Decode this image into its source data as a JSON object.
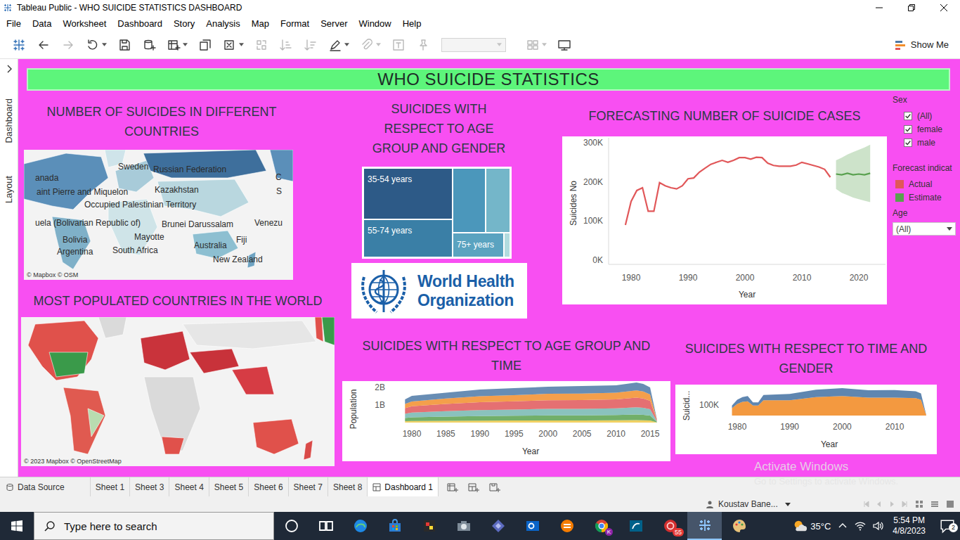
{
  "window": {
    "title": "Tableau Public - WHO SUICIDE STATISTICS DASHBOARD"
  },
  "menu": [
    "File",
    "Data",
    "Worksheet",
    "Dashboard",
    "Story",
    "Analysis",
    "Map",
    "Format",
    "Server",
    "Window",
    "Help"
  ],
  "toolbar": {
    "buttons": [
      {
        "kind": "logo",
        "disabled": false,
        "menu": false
      },
      {
        "kind": "undo",
        "disabled": false,
        "menu": false
      },
      {
        "kind": "redo",
        "disabled": true,
        "menu": false
      },
      {
        "kind": "replay",
        "disabled": false,
        "menu": true
      },
      {
        "kind": "save",
        "disabled": false,
        "menu": false
      },
      {
        "kind": "datasource",
        "disabled": false,
        "menu": false
      },
      {
        "kind": "newsheet",
        "disabled": false,
        "menu": true
      },
      {
        "kind": "duplicate",
        "disabled": false,
        "menu": false
      },
      {
        "kind": "clear",
        "disabled": false,
        "menu": true
      },
      {
        "kind": "swap",
        "disabled": true,
        "menu": false
      },
      {
        "kind": "sortasc",
        "disabled": true,
        "menu": false
      },
      {
        "kind": "sortdesc",
        "disabled": true,
        "menu": false
      },
      {
        "kind": "highlight",
        "disabled": false,
        "menu": true
      },
      {
        "kind": "attach",
        "disabled": true,
        "menu": true
      },
      {
        "kind": "label",
        "disabled": true,
        "menu": false
      },
      {
        "kind": "pin",
        "disabled": true,
        "menu": false
      },
      {
        "kind": "fitfield",
        "disabled": true,
        "menu": true
      },
      {
        "kind": "cards",
        "disabled": true,
        "menu": true
      },
      {
        "kind": "present",
        "disabled": false,
        "menu": false
      }
    ],
    "show_me": "Show Me"
  },
  "side_panel": {
    "tabs": [
      "Dashboard",
      "Layout"
    ]
  },
  "dashboard": {
    "title": "WHO SUICIDE STATISTICS",
    "country_map": {
      "title": "NUMBER OF SUICIDES IN DIFFERENT COUNTRIES",
      "labels": [
        "anada",
        "Sweden",
        "Russian Federation",
        "C",
        "aint Pierre and Miquelon",
        "Kazakhstan",
        "S",
        "Occupied Palestinian Territory",
        "uela (Bolivarian Republic of)",
        "Brunei Darussalam",
        "Venezu",
        "Mayotte",
        "Fiji",
        "Bolivia",
        "Argentina",
        "South Africa",
        "Australia",
        "New Zealand"
      ],
      "attribution": "© Mapbox © OSM"
    },
    "population_map": {
      "title": "MOST POPULATED COUNTRIES IN THE WORLD",
      "attribution": "© 2023 Mapbox © OpenStreetMap"
    },
    "treemap": {
      "title": "SUICIDES WITH RESPECT TO AGE GROUP AND GENDER",
      "cells": [
        {
          "label": "35-54 years",
          "value": 9271,
          "color": "#2d5a87"
        },
        {
          "label": "55-74 years",
          "value": 6731,
          "color": "#3a7fa6"
        },
        {
          "value": 4324,
          "color": "#4b97bb"
        },
        {
          "value": 3128,
          "color": "#74b6c9"
        },
        {
          "label": "75+ years",
          "value": 2550,
          "color": "#5aa3c0"
        },
        {
          "value": 238,
          "color": "#b2dcdf"
        }
      ]
    },
    "logo": {
      "lines": [
        "World Health",
        "Organization"
      ]
    },
    "forecast": {
      "title": "FORECASTING NUMBER OF SUICIDE CASES",
      "y_axis": {
        "label": "Suicides No",
        "ticks": [
          "300K",
          "200K",
          "100K",
          "0K"
        ]
      },
      "x_axis": {
        "label": "Year",
        "ticks": [
          "1980",
          "1990",
          "2000",
          "2010",
          "2020"
        ]
      },
      "actual": {
        "start_year": 1979,
        "values": [
          90000,
          150000,
          178000,
          185000,
          125000,
          125000,
          198000,
          190000,
          185000,
          182000,
          190000,
          208000,
          210000,
          225000,
          235000,
          245000,
          250000,
          255000,
          250000,
          255000,
          262000,
          262000,
          258000,
          263000,
          262000,
          248000,
          242000,
          240000,
          240000,
          240000,
          243000,
          250000,
          246000,
          242000,
          238000,
          232000,
          212000
        ]
      },
      "estimate": {
        "start_year": 2016,
        "values": [
          220000,
          218000,
          222000,
          218000,
          220000,
          218000,
          222000
        ],
        "lower": [
          182000,
          172000,
          166000,
          160000,
          156000,
          152000,
          148000
        ],
        "upper": [
          255000,
          262000,
          270000,
          276000,
          282000,
          288000,
          295000
        ]
      }
    },
    "filters": {
      "sex": {
        "title": "Sex",
        "options": [
          {
            "label": "(All)",
            "checked": true
          },
          {
            "label": "female",
            "checked": true
          },
          {
            "label": "male",
            "checked": true
          }
        ]
      },
      "forecast_indicator": {
        "title": "Forecast indicat",
        "items": [
          {
            "label": "Actual",
            "color": "#e15759"
          },
          {
            "label": "Estimate",
            "color": "#59a14f"
          }
        ]
      },
      "age": {
        "title": "Age",
        "value": "(All)"
      }
    },
    "age_time": {
      "title": "SUICIDES WITH RESPECT TO AGE GROUP AND TIME",
      "y_axis": {
        "label": "Population",
        "ticks": [
          "2B",
          "1B"
        ]
      },
      "x_axis": {
        "label": "Year",
        "ticks": [
          "1980",
          "1985",
          "1990",
          "1995",
          "2000",
          "2005",
          "2010",
          "2015"
        ]
      },
      "years": [
        1979,
        1980,
        1985,
        1990,
        1995,
        2000,
        2005,
        2010,
        2013,
        2014,
        2015,
        2016
      ],
      "series": [
        {
          "color": "#edc948",
          "values": [
            0.08,
            0.09,
            0.1,
            0.11,
            0.12,
            0.12,
            0.12,
            0.13,
            0.14,
            0.13,
            0.12,
            0.01
          ]
        },
        {
          "color": "#59a14f",
          "values": [
            0.18,
            0.21,
            0.24,
            0.26,
            0.27,
            0.29,
            0.29,
            0.3,
            0.32,
            0.31,
            0.28,
            0.03
          ]
        },
        {
          "color": "#76b7b2",
          "values": [
            0.24,
            0.27,
            0.31,
            0.34,
            0.35,
            0.37,
            0.37,
            0.38,
            0.41,
            0.4,
            0.36,
            0.04
          ]
        },
        {
          "color": "#e15759",
          "values": [
            0.32,
            0.36,
            0.41,
            0.45,
            0.47,
            0.49,
            0.5,
            0.51,
            0.55,
            0.53,
            0.48,
            0.05
          ]
        },
        {
          "color": "#f28e2b",
          "values": [
            0.24,
            0.27,
            0.31,
            0.34,
            0.35,
            0.37,
            0.37,
            0.38,
            0.41,
            0.4,
            0.36,
            0.04
          ]
        },
        {
          "color": "#4e79a7",
          "values": [
            0.26,
            0.32,
            0.33,
            0.38,
            0.4,
            0.4,
            0.43,
            0.42,
            0.45,
            0.43,
            0.4,
            0.03
          ]
        }
      ]
    },
    "gender_time": {
      "title": "SUICIDES WITH RESPECT TO TIME AND GENDER",
      "y_axis": {
        "label": "Suicid...",
        "ticks": [
          "100K"
        ]
      },
      "x_axis": {
        "label": "Year",
        "ticks": [
          "1980",
          "1990",
          "2000",
          "2010"
        ]
      },
      "years": [
        1979,
        1980,
        1981,
        1982,
        1983,
        1984,
        1985,
        1990,
        1995,
        2000,
        2005,
        2010,
        2014,
        2015,
        2016
      ],
      "series": [
        {
          "color": "#f28e2b",
          "values": [
            70000,
            110000,
            130000,
            135000,
            95000,
            95000,
            145000,
            145000,
            175000,
            185000,
            170000,
            170000,
            165000,
            150000,
            5000
          ]
        },
        {
          "color": "#4e79a7",
          "values": [
            25000,
            40000,
            45000,
            50000,
            30000,
            30000,
            50000,
            60000,
            70000,
            75000,
            70000,
            72000,
            65000,
            60000,
            2000
          ]
        }
      ]
    }
  },
  "sheet_tabs": [
    {
      "label": "Data Source",
      "kind": "source",
      "selected": false
    },
    {
      "label": "Sheet 1",
      "kind": "sheet",
      "selected": false
    },
    {
      "label": "Sheet 3",
      "kind": "sheet",
      "selected": false
    },
    {
      "label": "Sheet 4",
      "kind": "sheet",
      "selected": false
    },
    {
      "label": "Sheet 5",
      "kind": "sheet",
      "selected": false
    },
    {
      "label": "Sheet 6",
      "kind": "sheet",
      "selected": false
    },
    {
      "label": "Sheet 7",
      "kind": "sheet",
      "selected": false
    },
    {
      "label": "Sheet 8",
      "kind": "sheet",
      "selected": false
    },
    {
      "label": "Dashboard 1",
      "kind": "dashboard",
      "selected": true
    }
  ],
  "status_bar": {
    "user": "Koustav Bane..."
  },
  "watermark": {
    "title": "Activate Windows",
    "subtitle": "Go to Settings to activate Windows."
  },
  "taskbar": {
    "search_placeholder": "Type here to search",
    "apps": [
      {
        "kind": "cortana",
        "active": false
      },
      {
        "kind": "taskview",
        "active": false
      },
      {
        "kind": "edge",
        "active": false
      },
      {
        "kind": "store",
        "active": false
      },
      {
        "kind": "media",
        "active": false
      },
      {
        "kind": "camera",
        "active": false
      },
      {
        "kind": "power",
        "active": false
      },
      {
        "kind": "outlook",
        "active": false
      },
      {
        "kind": "orange",
        "active": false
      },
      {
        "kind": "chrome",
        "active": false,
        "profile": "K"
      },
      {
        "kind": "mysql",
        "active": false
      },
      {
        "kind": "opera",
        "active": false,
        "badge": "55"
      },
      {
        "kind": "tableau",
        "active": true
      },
      {
        "kind": "paint",
        "active": false
      }
    ],
    "weather": "35°C",
    "time": "5:54 PM",
    "date": "4/8/2023",
    "notifications": "2"
  }
}
